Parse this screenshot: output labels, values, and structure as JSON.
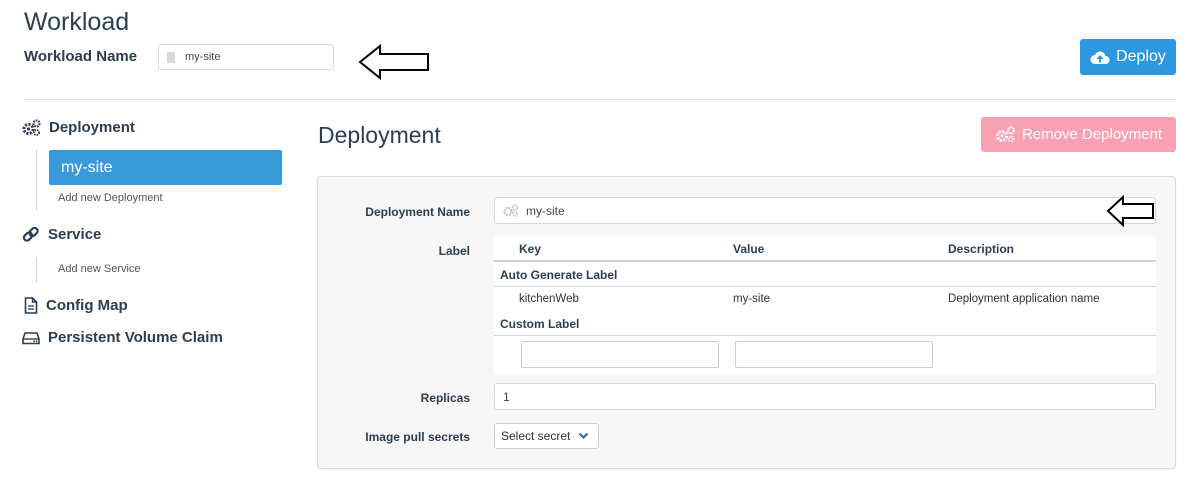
{
  "header": {
    "title": "Workload",
    "workload_name_label": "Workload Name",
    "workload_name_value": "my-site",
    "deploy_label": "Deploy"
  },
  "sidebar": {
    "deployment_label": "Deployment",
    "deployment_items": [
      "my-site"
    ],
    "add_deployment": "Add new Deployment",
    "service_label": "Service",
    "add_service": "Add new Service",
    "config_map_label": "Config Map",
    "pvc_label": "Persistent Volume Claim"
  },
  "main": {
    "section_title": "Deployment",
    "remove_label": "Remove Deployment",
    "form": {
      "deployment_name_label": "Deployment Name",
      "deployment_name_value": "my-site",
      "label_label": "Label",
      "label_table": {
        "headers": [
          "Key",
          "Value",
          "Description"
        ],
        "auto_group": "Auto Generate Label",
        "auto_rows": [
          {
            "key": "kitchenWeb",
            "value": "my-site",
            "description": "Deployment application name"
          }
        ],
        "custom_group": "Custom Label",
        "custom_key_value": "",
        "custom_value_value": ""
      },
      "replicas_label": "Replicas",
      "replicas_value": "1",
      "pull_secrets_label": "Image pull secrets",
      "pull_secrets_selected": "Select secret"
    }
  },
  "colors": {
    "primary": "#2d97e0",
    "active_nav": "#3a9ad9",
    "danger_disabled": "#f7a2b2",
    "text": "#2c3e50"
  },
  "icons": [
    "document-icon",
    "cloud-upload-icon",
    "cogs-icon",
    "link-icon",
    "file-icon",
    "hard-drive-icon",
    "chevron-down-icon",
    "arrow-left-icon"
  ]
}
